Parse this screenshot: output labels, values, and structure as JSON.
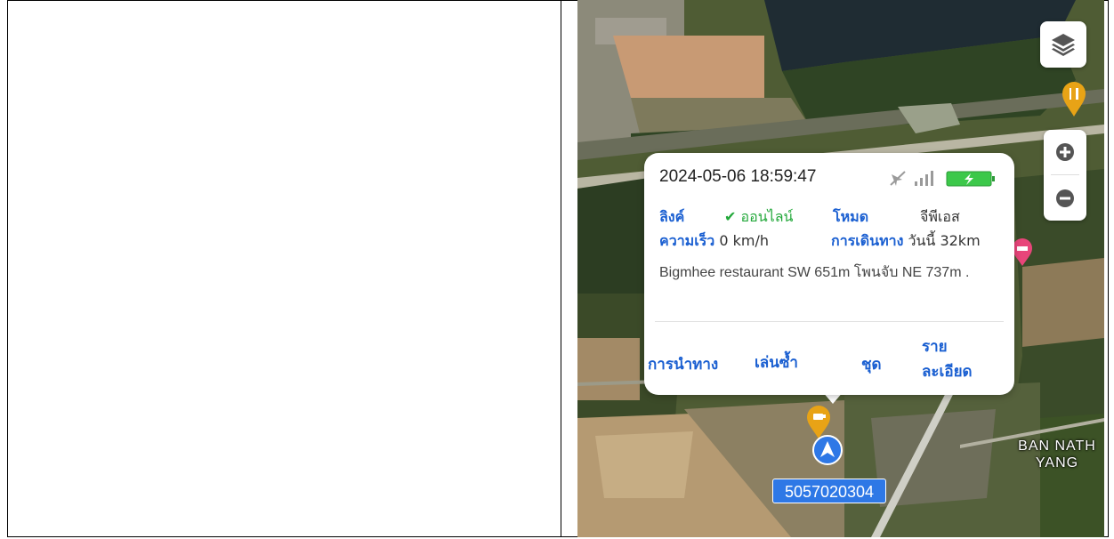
{
  "popup": {
    "timestamp": "2024-05-06 18:59:47",
    "link_label": "ลิงค์",
    "link_status": "ออนไลน์",
    "mode_label": "โหมด",
    "mode_value": "จีพีเอส",
    "speed_label": "ความเร็ว",
    "speed_value": "0 km/h",
    "trip_label": "การเดินทาง",
    "trip_value": "วันนี้ 32km",
    "address": "Bigmhee restaurant SW 651m โพนจับ NE 737m .",
    "actions": {
      "navigate": "การนำทาง",
      "playback": "เล่นซ้ำ",
      "set": "ชุด",
      "details_line1": "ราย",
      "details_line2": "ละเอียด"
    }
  },
  "vehicle": {
    "plate": "5057020304"
  },
  "map": {
    "village_line1": "BAN NATH",
    "village_line2": "YANG",
    "icons": [
      "layers-icon",
      "zoom-in-icon",
      "zoom-out-icon",
      "restaurant-marker-icon",
      "cafe-marker-icon",
      "hotel-marker-icon",
      "navigation-arrow-icon",
      "gps-off-icon",
      "signal-icon",
      "battery-charging-icon",
      "check-icon"
    ]
  },
  "colors": {
    "accent_blue": "#1a5fd1",
    "online_green": "#22a83a",
    "battery_green": "#3cc84a",
    "marker_orange": "#e8a316",
    "marker_pink": "#e8457a",
    "plate_blue": "#2e78e6"
  }
}
